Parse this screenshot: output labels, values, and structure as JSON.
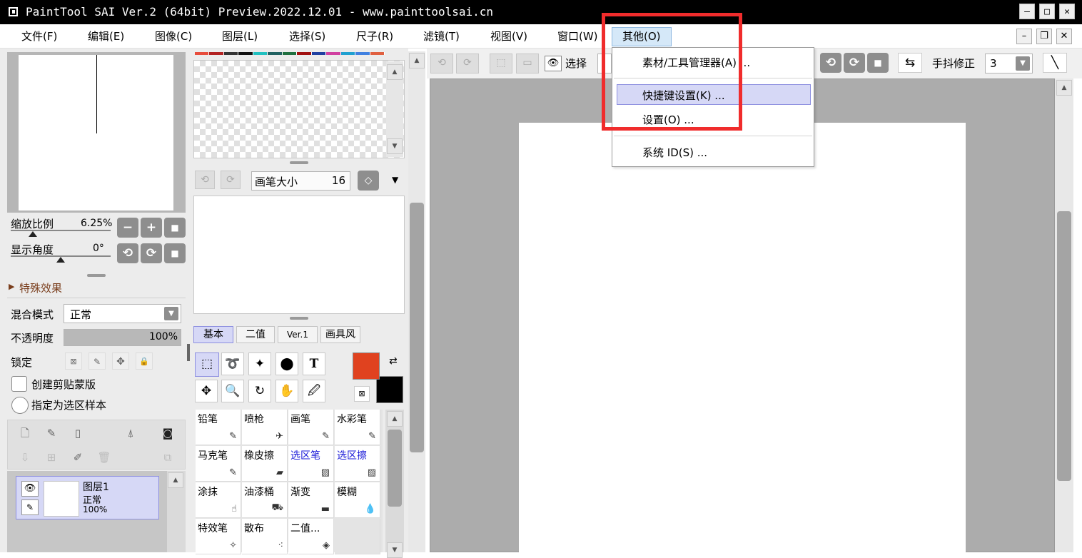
{
  "window": {
    "title": "PaintTool SAI Ver.2 (64bit) Preview.2022.12.01 - www.painttoolsai.cn",
    "minimize_glyph": "–",
    "maximize_glyph": "□",
    "close_glyph": "✕"
  },
  "menubar": {
    "items": [
      "文件(F)",
      "编辑(E)",
      "图像(C)",
      "图层(L)",
      "选择(S)",
      "尺子(R)",
      "滤镜(T)",
      "视图(V)",
      "窗口(W)",
      "其他(O)"
    ],
    "active_index": 9
  },
  "other_menu": {
    "items": [
      "素材/工具管理器(A) ...",
      "快捷键设置(K) ...",
      "设置(O) ...",
      "系统 ID(S) ..."
    ],
    "highlighted_index": 1
  },
  "navigator": {
    "zoom_label": "缩放比例",
    "zoom_value": "6.25%",
    "angle_label": "显示角度",
    "angle_value": "0°",
    "zoom_btn_minus": "−",
    "zoom_btn_plus": "+",
    "zoom_btn_reset": "■",
    "rot_btn_ccw": "⟲",
    "rot_btn_cw": "⟳",
    "rot_btn_reset": "■"
  },
  "layer_props": {
    "effects_label": "特殊效果",
    "blend_label": "混合模式",
    "blend_value": "正常",
    "opacity_label": "不透明度",
    "opacity_value": "100%",
    "lock_label": "锁定",
    "clip_label": "创建剪贴蒙版",
    "sample_label": "指定为选区样本"
  },
  "layer": {
    "name": "图层1",
    "mode": "正常",
    "opacity": "100%"
  },
  "brush_size": {
    "label": "画笔大小",
    "value": "16"
  },
  "tool_tabs": [
    "基本",
    "二值",
    "Ver.1",
    "画具风"
  ],
  "tool_tab_active": 0,
  "colors": {
    "foreground": "#e0421f",
    "background": "#000000",
    "palette": [
      "#e74c3c",
      "#b22222",
      "#333333",
      "#111111",
      "#20c0c0",
      "#206060",
      "#1f6f3f",
      "#a01010",
      "#1f3fa0",
      "#d040a0",
      "#20a0d0",
      "#4080e0",
      "#e06040"
    ],
    "accent_red": "#f02c2c"
  },
  "brushes": [
    {
      "name": "铅笔",
      "icon": "pencil-icon",
      "glyph": "✎",
      "blue": false
    },
    {
      "name": "喷枪",
      "icon": "airbrush-icon",
      "glyph": "✈",
      "blue": false
    },
    {
      "name": "画笔",
      "icon": "brush-icon",
      "glyph": "✎",
      "blue": false
    },
    {
      "name": "水彩笔",
      "icon": "watercolor-icon",
      "glyph": "✎",
      "blue": false
    },
    {
      "name": "马克笔",
      "icon": "marker-icon",
      "glyph": "✎",
      "blue": false
    },
    {
      "name": "橡皮擦",
      "icon": "eraser-icon",
      "glyph": "▰",
      "blue": false
    },
    {
      "name": "选区笔",
      "icon": "selpen-icon",
      "glyph": "▨",
      "blue": true
    },
    {
      "name": "选区擦",
      "icon": "selerase-icon",
      "glyph": "▨",
      "blue": true
    },
    {
      "name": "涂抹",
      "icon": "smudge-icon",
      "glyph": "☝",
      "blue": false
    },
    {
      "name": "油漆桶",
      "icon": "bucket-icon",
      "glyph": "⛟",
      "blue": false
    },
    {
      "name": "渐变",
      "icon": "gradient-icon",
      "glyph": "▬",
      "blue": false
    },
    {
      "name": "模糊",
      "icon": "blur-icon",
      "glyph": "💧",
      "blue": false
    },
    {
      "name": "特效笔",
      "icon": "fxpen-icon",
      "glyph": "✧",
      "blue": false
    },
    {
      "name": "散布",
      "icon": "scatter-icon",
      "glyph": "⁖",
      "blue": false
    },
    {
      "name": "二值...",
      "icon": "binary-icon",
      "glyph": "◈",
      "blue": false
    }
  ],
  "toolbar": {
    "select_label": "选择",
    "stabilizer_label": "手抖修正",
    "stabilizer_value": "3"
  }
}
